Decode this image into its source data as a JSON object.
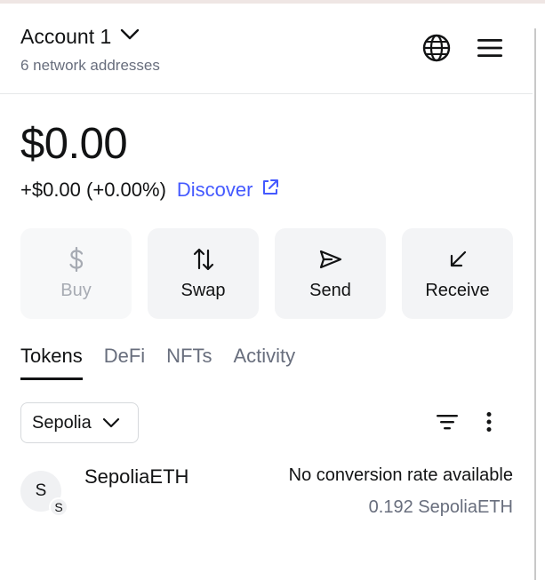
{
  "header": {
    "account_name": "Account 1",
    "network_addresses": "6 network addresses"
  },
  "balance": {
    "total": "$0.00",
    "change": "+$0.00 (+0.00%)",
    "discover_label": "Discover"
  },
  "actions": [
    {
      "label": "Buy",
      "icon": "dollar-icon",
      "enabled": false
    },
    {
      "label": "Swap",
      "icon": "swap-arrows-icon",
      "enabled": true
    },
    {
      "label": "Send",
      "icon": "send-icon",
      "enabled": true
    },
    {
      "label": "Receive",
      "icon": "receive-arrow-icon",
      "enabled": true
    }
  ],
  "tabs": [
    {
      "label": "Tokens",
      "active": true
    },
    {
      "label": "DeFi",
      "active": false
    },
    {
      "label": "NFTs",
      "active": false
    },
    {
      "label": "Activity",
      "active": false
    }
  ],
  "network_filter": {
    "selected": "Sepolia"
  },
  "tokens": [
    {
      "avatar_letter": "S",
      "badge_letter": "S",
      "name": "SepoliaETH",
      "fiat": "No conversion rate available",
      "amount": "0.192 SepoliaETH"
    }
  ],
  "colors": {
    "accent": "#4459ff",
    "muted_text": "#686e7d",
    "button_bg": "#f3f4f6",
    "text": "#121314"
  }
}
